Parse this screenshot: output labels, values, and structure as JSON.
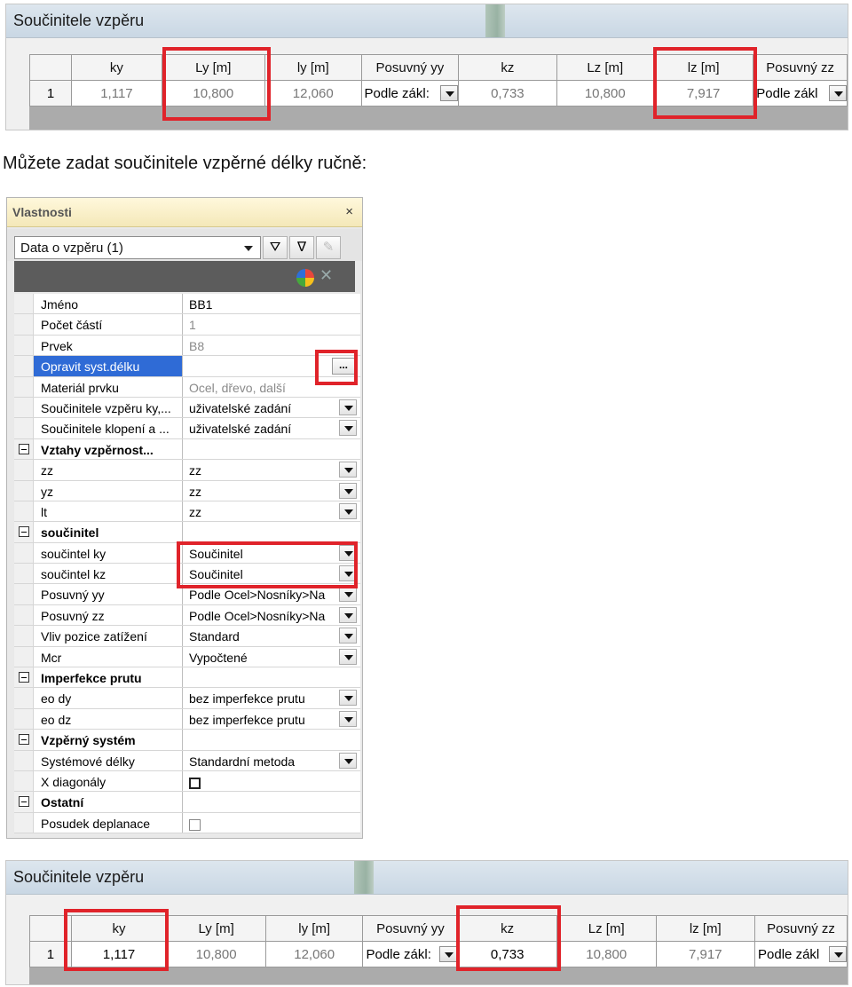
{
  "top_panel": {
    "title": "Součinitele vzpěru",
    "columns": [
      "",
      "ky",
      "Ly [m]",
      "ly [m]",
      "Posuvný yy",
      "kz",
      "Lz [m]",
      "lz [m]",
      "Posuvný zz"
    ],
    "row": {
      "n": "1",
      "ky": "1,117",
      "Ly": "10,800",
      "ly": "12,060",
      "posuvny_yy": "Podle zákl:",
      "kz": "0,733",
      "Lz": "10,800",
      "lz": "7,917",
      "posuvny_zz": "Podle zákl"
    }
  },
  "caption": "Můžete zadat součinitele vzpěrné délky ručně:",
  "properties": {
    "title": "Vlastnosti",
    "close": "×",
    "combo_value": "Data o vzpěru (1)",
    "rows": [
      {
        "k": "Jméno",
        "v": "BB1"
      },
      {
        "k": "Počet částí",
        "v": "1"
      },
      {
        "k": "Prvek",
        "v": "B8"
      },
      {
        "k": "Opravit syst.délku",
        "v": "",
        "btn": "..."
      },
      {
        "k": "Materiál prvku",
        "v": "Ocel, dřevo, další"
      },
      {
        "k": "Součinitele vzpěru ky,...",
        "v": "uživatelské zadání"
      },
      {
        "k": "Součinitele klopení a ...",
        "v": "uživatelské zadání"
      },
      {
        "k": "Vztahy vzpěrnost...",
        "v": ""
      },
      {
        "k": "zz",
        "v": "zz"
      },
      {
        "k": "yz",
        "v": "zz"
      },
      {
        "k": "lt",
        "v": "zz"
      },
      {
        "k": "součinitel",
        "v": ""
      },
      {
        "k": "součintel ky",
        "v": "Součinitel"
      },
      {
        "k": "součintel kz",
        "v": "Součinitel"
      },
      {
        "k": "Posuvný yy",
        "v": "Podle Ocel>Nosníky>Na"
      },
      {
        "k": "Posuvný zz",
        "v": "Podle Ocel>Nosníky>Na"
      },
      {
        "k": "Vliv pozice zatížení",
        "v": "Standard"
      },
      {
        "k": "Mcr",
        "v": "Vypočtené"
      },
      {
        "k": "Imperfekce prutu",
        "v": ""
      },
      {
        "k": "eo dy",
        "v": "bez imperfekce prutu"
      },
      {
        "k": "eo dz",
        "v": "bez imperfekce prutu"
      },
      {
        "k": "Vzpěrný systém",
        "v": ""
      },
      {
        "k": "Systémové délky",
        "v": "Standardní metoda"
      },
      {
        "k": "X diagonály",
        "v": ""
      },
      {
        "k": "Ostatní",
        "v": ""
      },
      {
        "k": "Posudek deplanace",
        "v": ""
      }
    ]
  },
  "bottom_panel": {
    "title": "Součinitele vzpěru",
    "columns": [
      "",
      "ky",
      "Ly [m]",
      "ly [m]",
      "Posuvný yy",
      "kz",
      "Lz [m]",
      "lz [m]",
      "Posuvný zz"
    ],
    "row": {
      "n": "1",
      "ky": "1,117",
      "Ly": "10,800",
      "ly": "12,060",
      "posuvny_yy": "Podle zákl:",
      "kz": "0,733",
      "Lz": "10,800",
      "lz": "7,917",
      "posuvny_zz": "Podle zákl"
    }
  },
  "colors": {
    "highlight_box": "#e0232a",
    "selected_row": "#2f6bd6",
    "props_header": "#f4e8b8"
  }
}
